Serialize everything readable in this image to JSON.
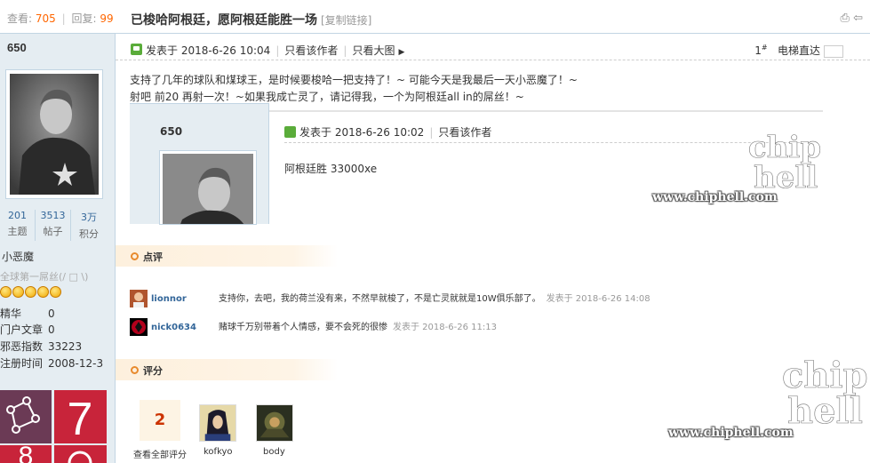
{
  "stats": {
    "views_label": "查看:",
    "views": "705",
    "replies_label": "回复:",
    "replies": "99"
  },
  "thread": {
    "title": "已梭哈阿根廷，愿阿根廷能胜一场",
    "copy_link": "[复制链接]"
  },
  "author": {
    "name": "650",
    "counts": [
      {
        "value": "201",
        "label": "主题"
      },
      {
        "value": "3513",
        "label": "帖子"
      },
      {
        "value": "3万",
        "label": "积分"
      }
    ],
    "rank": "小恶魔",
    "rank_title": "全球第一屌丝(/ □ \\)",
    "profile": [
      {
        "key": "精华",
        "value": "0"
      },
      {
        "key": "门户文章",
        "value": "0"
      },
      {
        "key": "邪恶指数",
        "value": "33223"
      },
      {
        "key": "注册时间",
        "value": "2008-12-3"
      }
    ]
  },
  "post": {
    "meta_posted": "发表于 2018-6-26 10:04",
    "only_author": "只看该作者",
    "big_image": "只看大图",
    "floor": "1",
    "floor_suffix": "#",
    "elevator": "电梯直达",
    "body_line1": "支持了几年的球队和煤球王，是时候要梭哈一把支持了！~  可能今天是我最后一天小恶魔了！~",
    "body_line2": "射吧 前20  再射一次！~如果我成亡灵了，请记得我，一个为阿根廷all in的屌丝！~"
  },
  "quote": {
    "name": "650",
    "meta_posted": "发表于 2018-6-26 10:02",
    "only_author": "只看该作者",
    "body": "阿根廷胜   33000xe"
  },
  "comments_section": {
    "label": "点评"
  },
  "comments": [
    {
      "user": "lionnor",
      "text": "支持你，去吧，我的荷兰没有来，不然早就梭了，不是亡灵就就是10W俱乐部了。",
      "time": "发表于 2018-6-26 14:08"
    },
    {
      "user": "nick0634",
      "text": "赌球千万别带着个人情感，要不会死的很惨",
      "time": "发表于 2018-6-26 11:13"
    }
  ],
  "rating_section": {
    "label": "评分"
  },
  "rating": {
    "count": "2",
    "view_all": "查看全部评分",
    "raters": [
      {
        "name": "kofkyo"
      },
      {
        "name": "body"
      }
    ]
  },
  "watermark": {
    "logo_line1": "chip",
    "logo_line2": "hell",
    "url": "www.chiphell.com"
  },
  "colors": {
    "link_blue": "#336699",
    "accent_orange": "#ff6600",
    "sidebar_bg": "#e5edf2",
    "online_green": "#5aac3a"
  }
}
